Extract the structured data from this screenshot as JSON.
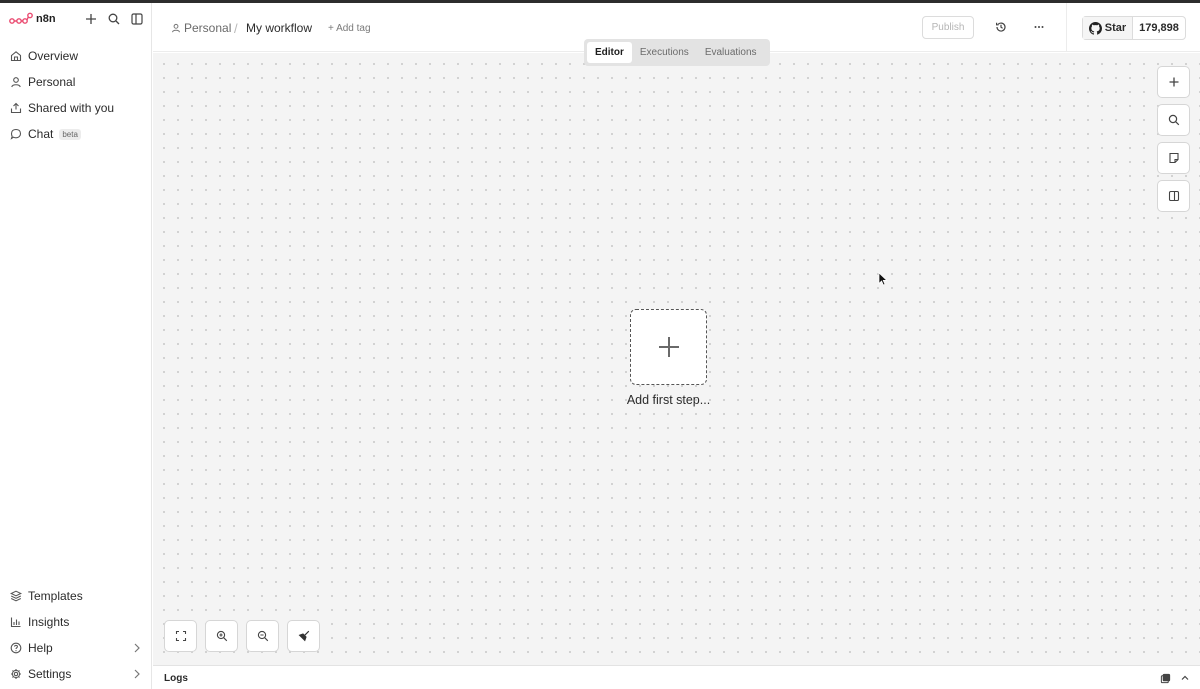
{
  "app": {
    "brand": "n8n",
    "accent_color": "#ea4b71"
  },
  "sidebar": {
    "top_items": [
      {
        "label": "Overview",
        "icon": "home-icon"
      },
      {
        "label": "Personal",
        "icon": "user-icon"
      },
      {
        "label": "Shared with you",
        "icon": "share-icon"
      },
      {
        "label": "Chat",
        "icon": "chat-icon",
        "badge": "beta"
      }
    ],
    "bottom_items": [
      {
        "label": "Templates",
        "icon": "templates-icon"
      },
      {
        "label": "Insights",
        "icon": "insights-icon"
      },
      {
        "label": "Help",
        "icon": "help-icon"
      },
      {
        "label": "Settings",
        "icon": "gear-icon"
      }
    ]
  },
  "header": {
    "breadcrumb_project": "Personal",
    "breadcrumb_separator": "/",
    "workflow_name": "My workflow",
    "add_tag": "+ Add tag",
    "publish_label": "Publish",
    "github_star_label": "Star",
    "github_star_count": "179,898"
  },
  "tabs": [
    {
      "label": "Editor",
      "active": true
    },
    {
      "label": "Executions",
      "active": false
    },
    {
      "label": "Evaluations",
      "active": false
    }
  ],
  "canvas": {
    "add_first_step": "Add first step..."
  },
  "logs": {
    "title": "Logs"
  }
}
